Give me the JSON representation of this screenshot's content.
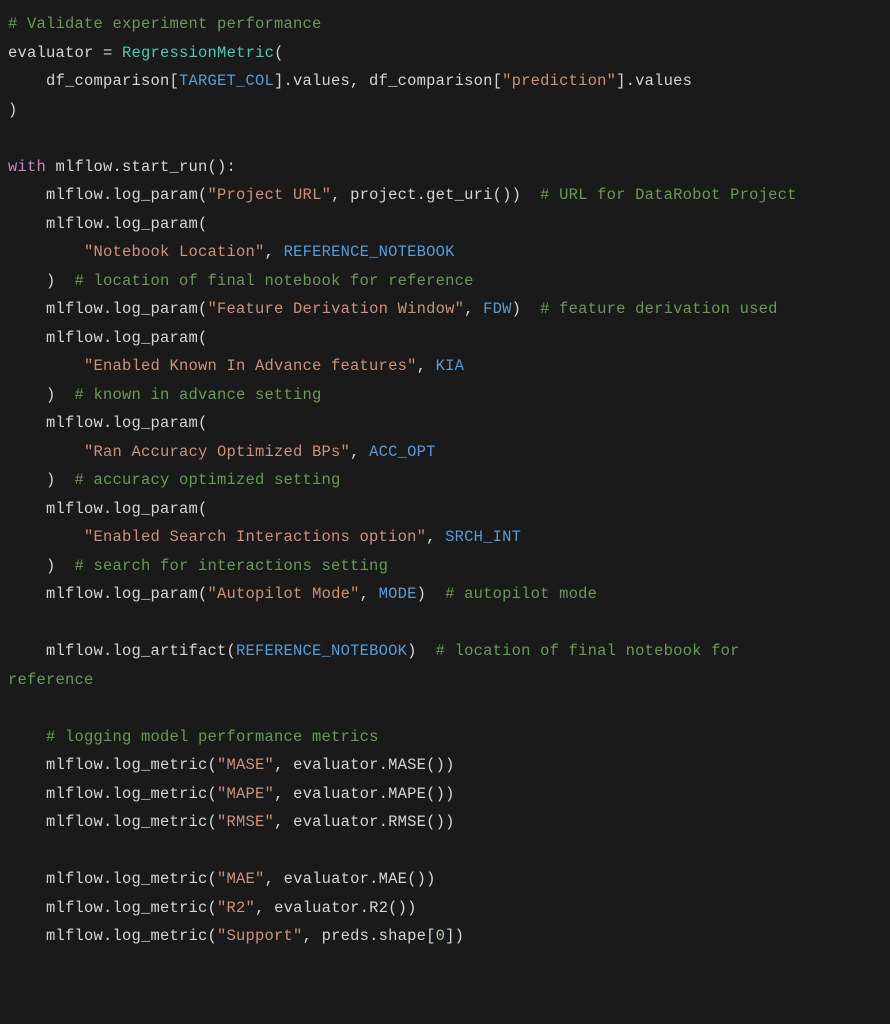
{
  "code": {
    "lines": [
      [
        {
          "t": "# Validate experiment performance",
          "c": "cm"
        }
      ],
      [
        {
          "t": "evaluator ",
          "c": "id"
        },
        {
          "t": "=",
          "c": "pn"
        },
        {
          "t": " ",
          "c": "id"
        },
        {
          "t": "RegressionMetric",
          "c": "fn"
        },
        {
          "t": "(",
          "c": "pn"
        }
      ],
      [
        {
          "t": "    df_comparison[",
          "c": "id"
        },
        {
          "t": "TARGET_COL",
          "c": "cst"
        },
        {
          "t": "].values, df_comparison[",
          "c": "id"
        },
        {
          "t": "\"prediction\"",
          "c": "str"
        },
        {
          "t": "].values",
          "c": "id"
        }
      ],
      [
        {
          "t": ")",
          "c": "pn"
        }
      ],
      [
        {
          "t": "",
          "c": "id"
        }
      ],
      [
        {
          "t": "with",
          "c": "kw"
        },
        {
          "t": " mlflow.start_run():",
          "c": "id"
        }
      ],
      [
        {
          "t": "    mlflow.log_param(",
          "c": "id"
        },
        {
          "t": "\"Project URL\"",
          "c": "str"
        },
        {
          "t": ", project.get_uri())  ",
          "c": "id"
        },
        {
          "t": "# URL for DataRobot Project",
          "c": "cm"
        }
      ],
      [
        {
          "t": "    mlflow.log_param(",
          "c": "id"
        }
      ],
      [
        {
          "t": "        ",
          "c": "id"
        },
        {
          "t": "\"Notebook Location\"",
          "c": "str"
        },
        {
          "t": ", ",
          "c": "id"
        },
        {
          "t": "REFERENCE_NOTEBOOK",
          "c": "cst"
        }
      ],
      [
        {
          "t": "    )  ",
          "c": "id"
        },
        {
          "t": "# location of final notebook for reference",
          "c": "cm"
        }
      ],
      [
        {
          "t": "    mlflow.log_param(",
          "c": "id"
        },
        {
          "t": "\"Feature Derivation Window\"",
          "c": "str"
        },
        {
          "t": ", ",
          "c": "id"
        },
        {
          "t": "FDW",
          "c": "cst"
        },
        {
          "t": ")  ",
          "c": "id"
        },
        {
          "t": "# feature derivation used",
          "c": "cm"
        }
      ],
      [
        {
          "t": "    mlflow.log_param(",
          "c": "id"
        }
      ],
      [
        {
          "t": "        ",
          "c": "id"
        },
        {
          "t": "\"Enabled Known In Advance features\"",
          "c": "str"
        },
        {
          "t": ", ",
          "c": "id"
        },
        {
          "t": "KIA",
          "c": "cst"
        }
      ],
      [
        {
          "t": "    )  ",
          "c": "id"
        },
        {
          "t": "# known in advance setting",
          "c": "cm"
        }
      ],
      [
        {
          "t": "    mlflow.log_param(",
          "c": "id"
        }
      ],
      [
        {
          "t": "        ",
          "c": "id"
        },
        {
          "t": "\"Ran Accuracy Optimized BPs\"",
          "c": "str"
        },
        {
          "t": ", ",
          "c": "id"
        },
        {
          "t": "ACC_OPT",
          "c": "cst"
        }
      ],
      [
        {
          "t": "    )  ",
          "c": "id"
        },
        {
          "t": "# accuracy optimized setting",
          "c": "cm"
        }
      ],
      [
        {
          "t": "    mlflow.log_param(",
          "c": "id"
        }
      ],
      [
        {
          "t": "        ",
          "c": "id"
        },
        {
          "t": "\"Enabled Search Interactions option\"",
          "c": "str"
        },
        {
          "t": ", ",
          "c": "id"
        },
        {
          "t": "SRCH_INT",
          "c": "cst"
        }
      ],
      [
        {
          "t": "    )  ",
          "c": "id"
        },
        {
          "t": "# search for interactions setting",
          "c": "cm"
        }
      ],
      [
        {
          "t": "    mlflow.log_param(",
          "c": "id"
        },
        {
          "t": "\"Autopilot Mode\"",
          "c": "str"
        },
        {
          "t": ", ",
          "c": "id"
        },
        {
          "t": "MODE",
          "c": "cst"
        },
        {
          "t": ")  ",
          "c": "id"
        },
        {
          "t": "# autopilot mode",
          "c": "cm"
        }
      ],
      [
        {
          "t": "",
          "c": "id"
        }
      ],
      [
        {
          "t": "    mlflow.log_artifact(",
          "c": "id"
        },
        {
          "t": "REFERENCE_NOTEBOOK",
          "c": "cst"
        },
        {
          "t": ")  ",
          "c": "id"
        },
        {
          "t": "# location of final notebook for ",
          "c": "cm"
        }
      ],
      [
        {
          "t": "reference",
          "c": "cm"
        }
      ],
      [
        {
          "t": "",
          "c": "id"
        }
      ],
      [
        {
          "t": "    ",
          "c": "id"
        },
        {
          "t": "# logging model performance metrics",
          "c": "cm"
        }
      ],
      [
        {
          "t": "    mlflow.log_metric(",
          "c": "id"
        },
        {
          "t": "\"MASE\"",
          "c": "str"
        },
        {
          "t": ", evaluator.MASE())",
          "c": "id"
        }
      ],
      [
        {
          "t": "    mlflow.log_metric(",
          "c": "id"
        },
        {
          "t": "\"MAPE\"",
          "c": "str"
        },
        {
          "t": ", evaluator.MAPE())",
          "c": "id"
        }
      ],
      [
        {
          "t": "    mlflow.log_metric(",
          "c": "id"
        },
        {
          "t": "\"RMSE\"",
          "c": "str"
        },
        {
          "t": ", evaluator.RMSE())",
          "c": "id"
        }
      ],
      [
        {
          "t": "",
          "c": "id"
        }
      ],
      [
        {
          "t": "    mlflow.log_metric(",
          "c": "id"
        },
        {
          "t": "\"MAE\"",
          "c": "str"
        },
        {
          "t": ", evaluator.MAE())",
          "c": "id"
        }
      ],
      [
        {
          "t": "    mlflow.log_metric(",
          "c": "id"
        },
        {
          "t": "\"R2\"",
          "c": "str"
        },
        {
          "t": ", evaluator.R2())",
          "c": "id"
        }
      ],
      [
        {
          "t": "    mlflow.log_metric(",
          "c": "id"
        },
        {
          "t": "\"Support\"",
          "c": "str"
        },
        {
          "t": ", preds.shape[",
          "c": "id"
        },
        {
          "t": "0",
          "c": "num"
        },
        {
          "t": "])",
          "c": "id"
        }
      ]
    ]
  }
}
